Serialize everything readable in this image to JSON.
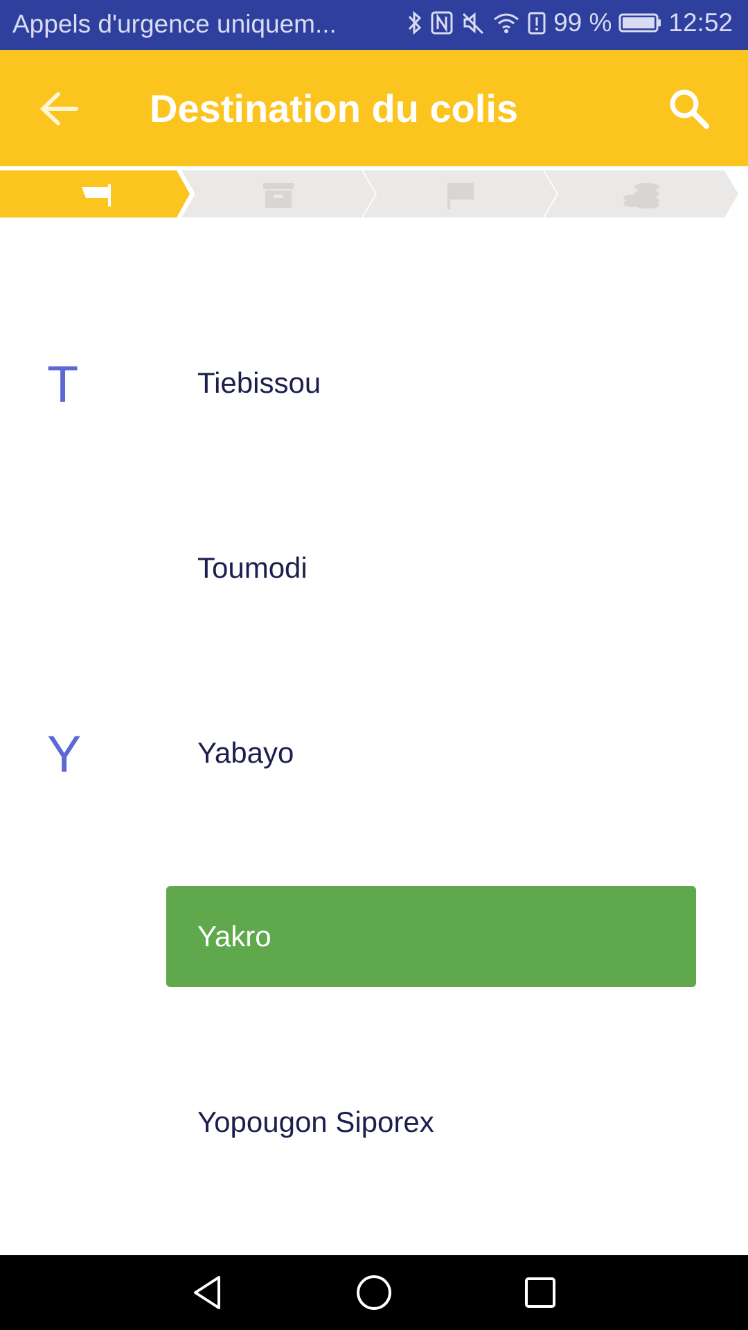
{
  "status_bar": {
    "carrier_text": "Appels d'urgence uniquem...",
    "battery_percent": "99 %",
    "time": "12:52"
  },
  "app_bar": {
    "title": "Destination du colis",
    "back_icon": "arrow-left-icon",
    "search_icon": "search-icon",
    "color": "#fcc41e"
  },
  "stepper": {
    "steps": [
      {
        "icon": "signpost-icon",
        "active": true
      },
      {
        "icon": "box-icon",
        "active": false
      },
      {
        "icon": "flag-icon",
        "active": false
      },
      {
        "icon": "coins-icon",
        "active": false
      }
    ],
    "active_color": "#fcc41e",
    "inactive_color": "#ebe9e8"
  },
  "list": {
    "sections": [
      {
        "letter": "T",
        "items": [
          "Tiebissou",
          "Toumodi"
        ]
      },
      {
        "letter": "Y",
        "items": [
          "Yabayo",
          "Yakro",
          "Yopougon Siporex"
        ]
      }
    ],
    "selected": "Yakro",
    "selected_color": "#5fa84c",
    "letter_color": "#5b68d6"
  },
  "nav_bar": {
    "buttons": [
      "back-triangle-icon",
      "home-circle-icon",
      "recents-square-icon"
    ]
  }
}
